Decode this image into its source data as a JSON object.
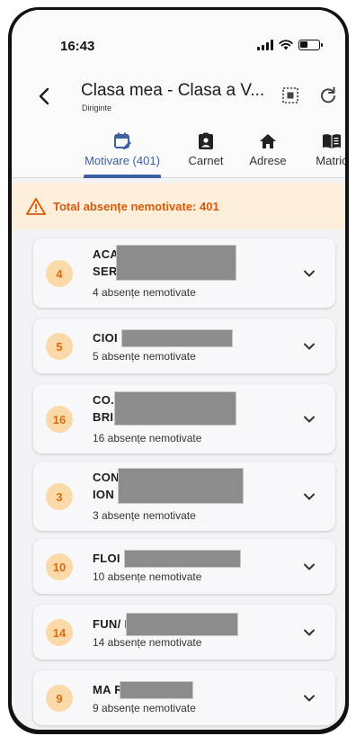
{
  "status_bar": {
    "time": "16:43"
  },
  "app_bar": {
    "title": "Clasa mea - Clasa a V...",
    "subtitle": "Diriginte"
  },
  "tabs": [
    {
      "label": "Motivare (401)",
      "icon": "calendar-edit-icon",
      "active": true
    },
    {
      "label": "Carnet",
      "icon": "clipboard-account-icon",
      "active": false
    },
    {
      "label": "Adrese",
      "icon": "home-icon",
      "active": false
    },
    {
      "label": "Matric",
      "icon": "book-icon",
      "active": false
    }
  ],
  "alert": {
    "icon": "warning-icon",
    "text": "Total absențe nemotivate: 401"
  },
  "students": [
    {
      "count": "4",
      "name_line1": "ACA",
      "name_line2": "SER",
      "subtitle": "4 absențe nemotivate"
    },
    {
      "count": "5",
      "name_line1": "CIOI                    NUȚ",
      "name_line2": "",
      "subtitle": "5 absențe nemotivate"
    },
    {
      "count": "16",
      "name_line1": "CO.                          LAS-",
      "name_line2": "BRI",
      "subtitle": "16 absențe nemotivate"
    },
    {
      "count": "3",
      "name_line1": "CON                         DRU-",
      "name_line2": "ION",
      "subtitle": "3 absențe nemotivate"
    },
    {
      "count": "10",
      "name_line1": "FLOI                        ILIA",
      "name_line2": "",
      "subtitle": "10 absențe nemotivate"
    },
    {
      "count": "14",
      "name_line1": "FUN/                         NIEL",
      "name_line2": "",
      "subtitle": "14 absențe nemotivate"
    },
    {
      "count": "9",
      "name_line1": "MA                    RIEL-MIHAI",
      "name_line2": "",
      "subtitle": "9 absențe nemotivate"
    }
  ],
  "colors": {
    "accent": "#3f5fa5",
    "warning_text": "#d9580a",
    "warning_bg": "#fdeed9",
    "badge_bg": "#fbd9a8",
    "badge_text": "#e06a10"
  }
}
